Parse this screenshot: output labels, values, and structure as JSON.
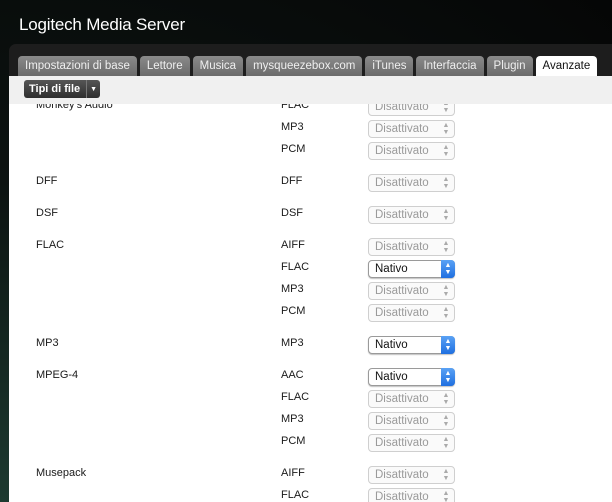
{
  "app": {
    "brand": "Logitech",
    "title": "Media Server"
  },
  "tabs": [
    {
      "label": "Impostazioni di base",
      "active": false
    },
    {
      "label": "Lettore",
      "active": false
    },
    {
      "label": "Musica",
      "active": false
    },
    {
      "label": "mysqueezebox.com",
      "active": false
    },
    {
      "label": "iTunes",
      "active": false
    },
    {
      "label": "Interfaccia",
      "active": false
    },
    {
      "label": "Plugin",
      "active": false
    },
    {
      "label": "Avanzate",
      "active": true
    }
  ],
  "subbar": {
    "filetype_label": "Tipi di file"
  },
  "rows": [
    {
      "format": "Monkey's Audio",
      "output": "FLAC",
      "value": "Disattivato",
      "active": false
    },
    {
      "format": "",
      "output": "MP3",
      "value": "Disattivato",
      "active": false
    },
    {
      "format": "",
      "output": "PCM",
      "value": "Disattivato",
      "active": false
    },
    {
      "format": "DFF",
      "output": "DFF",
      "value": "Disattivato",
      "active": false
    },
    {
      "format": "DSF",
      "output": "DSF",
      "value": "Disattivato",
      "active": false
    },
    {
      "format": "FLAC",
      "output": "AIFF",
      "value": "Disattivato",
      "active": false
    },
    {
      "format": "",
      "output": "FLAC",
      "value": "Nativo",
      "active": true
    },
    {
      "format": "",
      "output": "MP3",
      "value": "Disattivato",
      "active": false
    },
    {
      "format": "",
      "output": "PCM",
      "value": "Disattivato",
      "active": false
    },
    {
      "format": "MP3",
      "output": "MP3",
      "value": "Nativo",
      "active": true
    },
    {
      "format": "MPEG-4",
      "output": "AAC",
      "value": "Nativo",
      "active": true
    },
    {
      "format": "",
      "output": "FLAC",
      "value": "Disattivato",
      "active": false
    },
    {
      "format": "",
      "output": "MP3",
      "value": "Disattivato",
      "active": false
    },
    {
      "format": "",
      "output": "PCM",
      "value": "Disattivato",
      "active": false
    },
    {
      "format": "Musepack",
      "output": "AIFF",
      "value": "Disattivato",
      "active": false
    },
    {
      "format": "",
      "output": "FLAC",
      "value": "Disattivato",
      "active": false
    }
  ]
}
